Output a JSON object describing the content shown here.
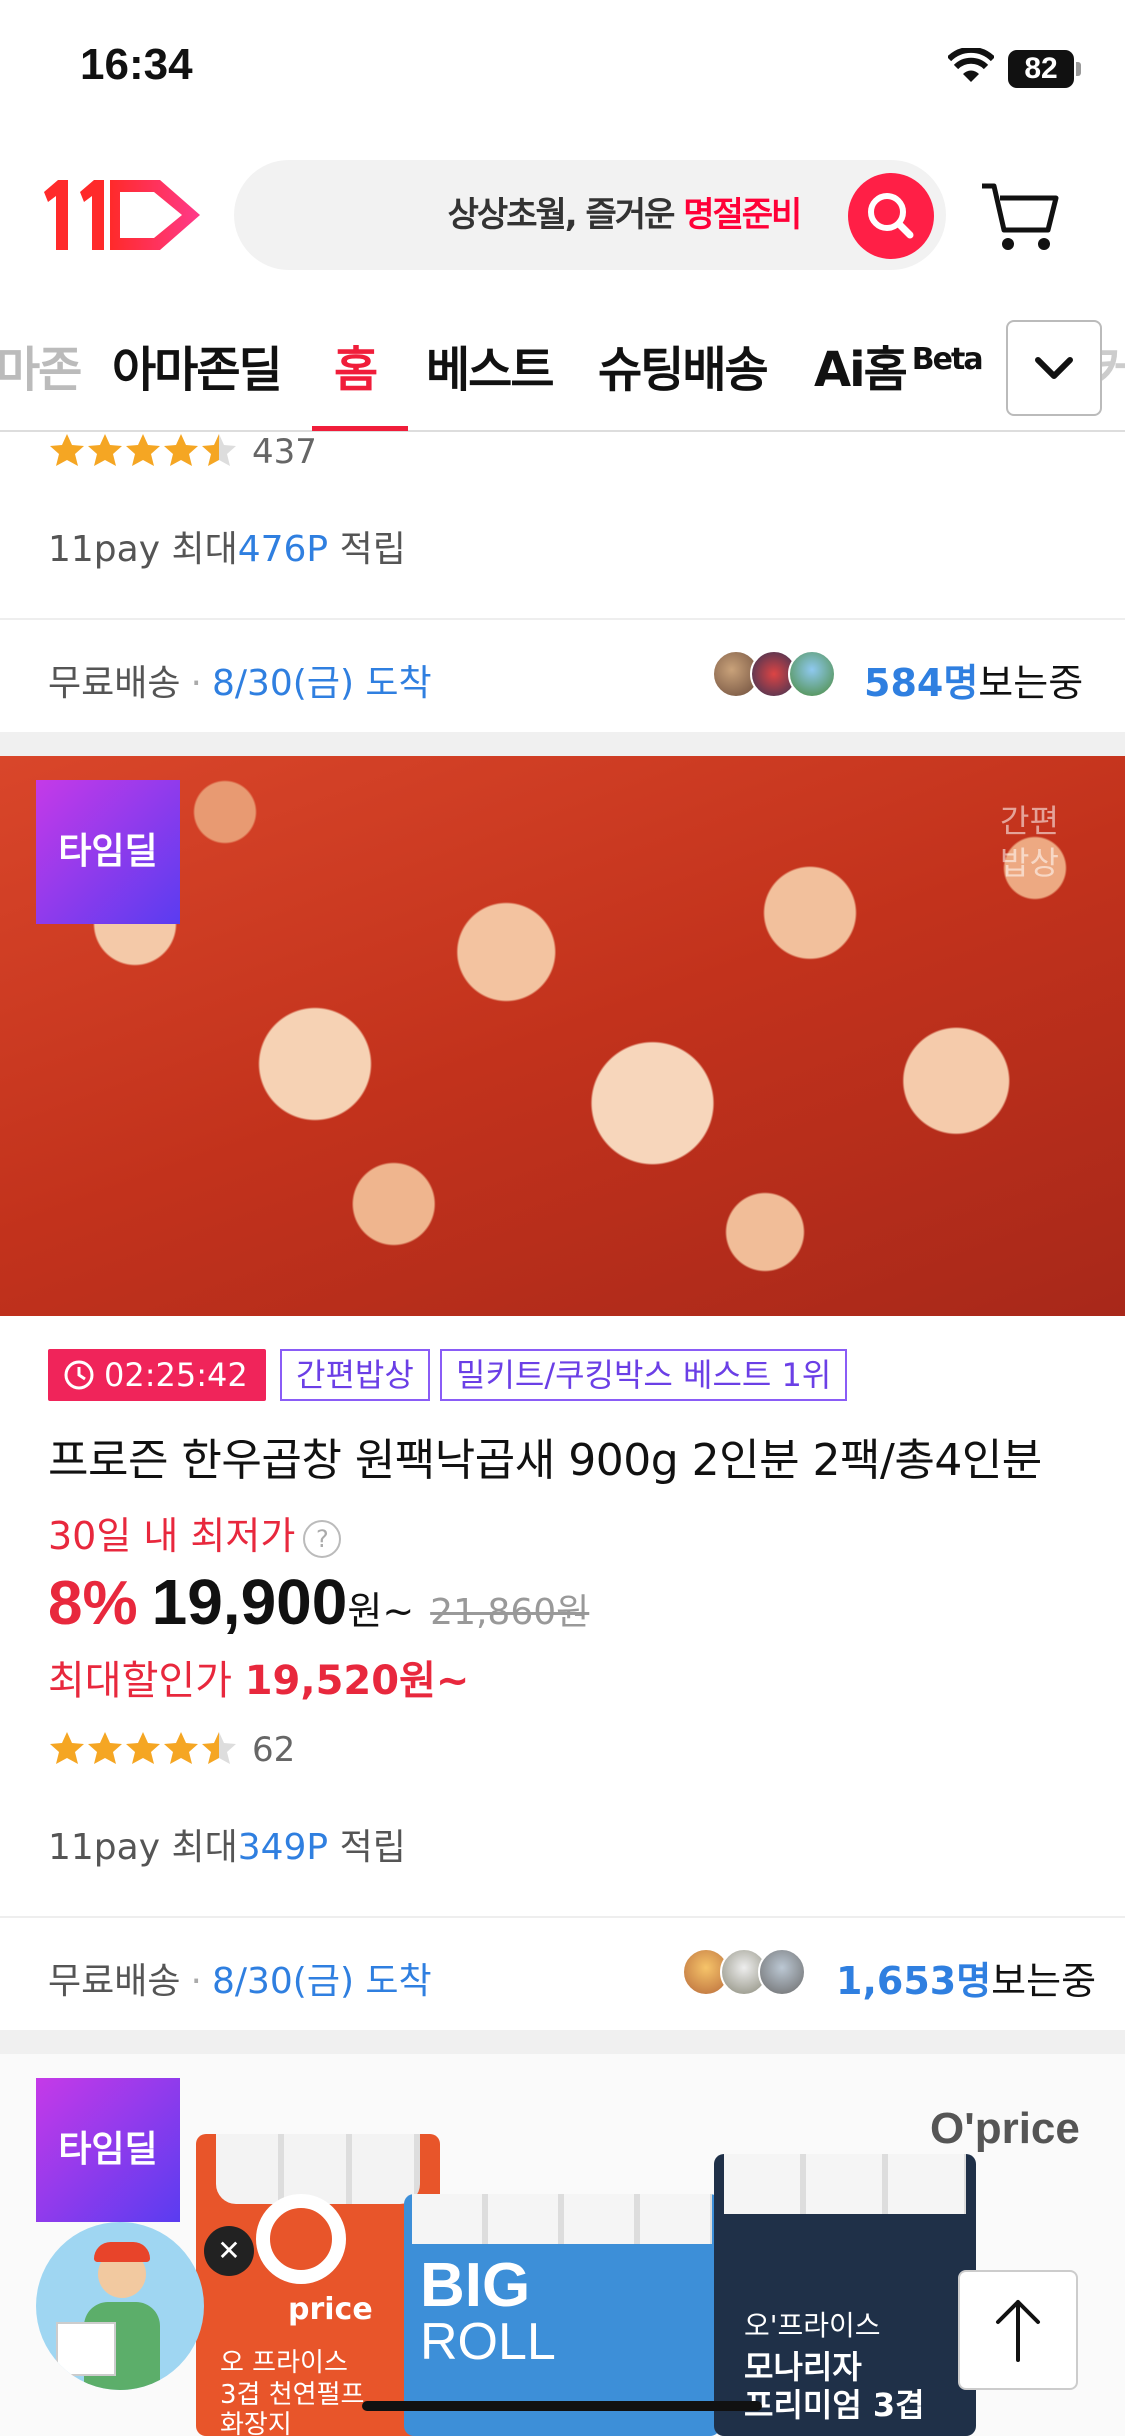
{
  "status": {
    "time": "16:34",
    "battery": "82"
  },
  "header": {
    "logo": "11",
    "search_text_plain": "상상초월, 즐거운 ",
    "search_text_highlight": "명절준비"
  },
  "tabs": [
    {
      "label": "마존"
    },
    {
      "label": "아마존딜"
    },
    {
      "label": "홈",
      "active": true
    },
    {
      "label": "베스트"
    },
    {
      "label": "슈팅배송"
    },
    {
      "label": "Ai홈",
      "sup": "Beta"
    },
    {
      "label": "이커"
    }
  ],
  "product_top": {
    "rating": 4.5,
    "rating_count": "437",
    "pay_prefix": "11pay 최대",
    "pay_points": "476P",
    "pay_suffix": " 적립",
    "shipping": "무료배송",
    "arrival": "8/30(금) 도착",
    "viewers_count": "584명",
    "viewers_label": "보는중"
  },
  "product_main": {
    "badge": "타임딜",
    "image_watermark": [
      "간편",
      "밥상"
    ],
    "timer": "02:25:42",
    "tags": [
      "간편밥상",
      "밀키트/쿠킹박스 베스트 1위"
    ],
    "title": "프로즌 한우곱창 원팩낙곱새 900g 2인분 2팩/총4인분",
    "lowest_label": "30일 내 최저가",
    "discount": "8%",
    "price": "19,900",
    "price_unit": "원~",
    "original_price": "21,860원",
    "max_discount_label": "최대할인가 ",
    "max_discount_price": "19,520원~",
    "rating": 4.5,
    "rating_count": "62",
    "pay_prefix": "11pay 최대",
    "pay_points": "349P",
    "pay_suffix": " 적립",
    "shipping": "무료배송",
    "arrival": "8/30(금) 도착",
    "viewers_count": "1,653명",
    "viewers_label": "보는중"
  },
  "product_next": {
    "badge": "타임딜",
    "brand": "O'price",
    "pack1_brand": "price",
    "pack1_lines": [
      "오 프라이스",
      "3겹 천연펄프",
      "화장지"
    ],
    "pack2_big": "BIG",
    "pack2_roll": "ROLL",
    "pack3_lines": [
      "오'프라이스",
      "모나리자",
      "프리미엄 3겹"
    ]
  },
  "floating": {
    "close_symbol": "✕",
    "scroll_top_symbol": "↑"
  },
  "colors": {
    "brand_red": "#ff0038",
    "point_blue": "#2f7fe0",
    "price_red": "#e8283d",
    "tag_purple": "#8a5cf6"
  }
}
